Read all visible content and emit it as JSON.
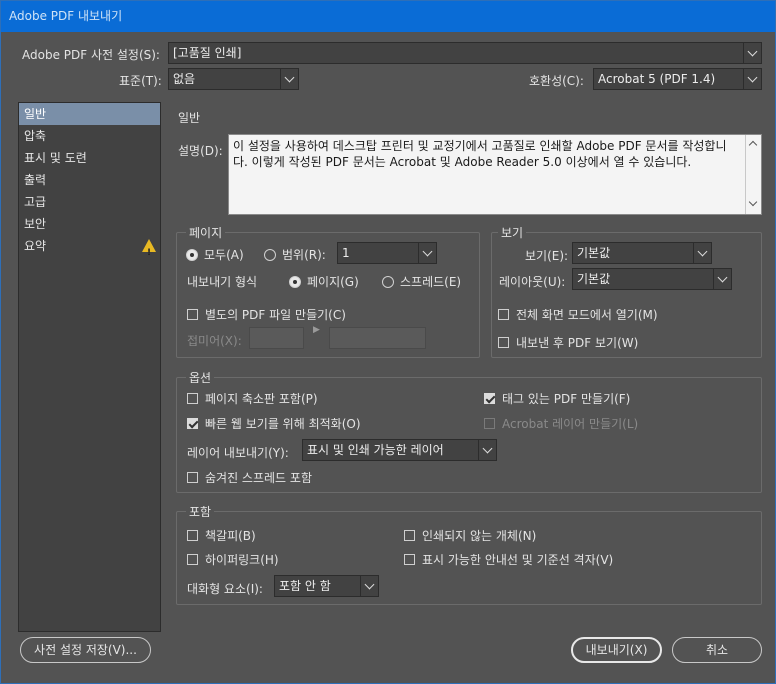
{
  "window": {
    "title": "Adobe PDF 내보내기"
  },
  "header": {
    "preset_label": "Adobe PDF 사전 설정(S):",
    "preset_value": "[고품질 인쇄]",
    "standard_label": "표준(T):",
    "standard_value": "없음",
    "compat_label": "호환성(C):",
    "compat_value": "Acrobat 5 (PDF 1.4)"
  },
  "sidebar": {
    "items": [
      {
        "label": "일반"
      },
      {
        "label": "압축"
      },
      {
        "label": "표시 및 도련"
      },
      {
        "label": "출력"
      },
      {
        "label": "고급"
      },
      {
        "label": "보안"
      },
      {
        "label": "요약"
      }
    ],
    "warning_glyph": "!"
  },
  "general": {
    "section_title": "일반",
    "desc_label": "설명(D):",
    "desc_text": "이 설정을 사용하여 데스크탑 프린터 및 교정기에서 고품질로 인쇄할 Adobe PDF 문서를 작성합니다. 이렇게 작성된 PDF 문서는 Acrobat 및 Adobe Reader 5.0 이상에서 열 수 있습니다."
  },
  "pages": {
    "title": "페이지",
    "all_label": "모두(A)",
    "range_label": "범위(R):",
    "range_value": "1",
    "export_as_label": "내보내기 형식",
    "pages_label": "페이지(G)",
    "spreads_label": "스프레드(E)",
    "separate_label": "별도의 PDF 파일 만들기(C)",
    "suffix_label": "접미어(X):"
  },
  "view": {
    "title": "보기",
    "view_label": "보기(E):",
    "view_value": "기본값",
    "layout_label": "레이아웃(U):",
    "layout_value": "기본값",
    "fullscreen_label": "전체 화면 모드에서 열기(M)",
    "after_export_label": "내보낸 후 PDF 보기(W)"
  },
  "options": {
    "title": "옵션",
    "thumbnails_label": "페이지 축소판 포함(P)",
    "optimize_label": "빠른 웹 보기를 위해 최적화(O)",
    "tagged_label": "태그 있는 PDF 만들기(F)",
    "acrobat_layers_label": "Acrobat 레이어 만들기(L)",
    "export_layers_label": "레이어 내보내기(Y):",
    "export_layers_value": "표시 및 인쇄 가능한 레이어",
    "hidden_spreads_label": "숨겨진 스프레드 포함"
  },
  "include": {
    "title": "포함",
    "bookmarks_label": "책갈피(B)",
    "hyperlinks_label": "하이퍼링크(H)",
    "nonprinting_label": "인쇄되지 않는 개체(N)",
    "guides_label": "표시 가능한 안내선 및 기준선 격자(V)",
    "interactive_label": "대화형 요소(I):",
    "interactive_value": "포함 안 함"
  },
  "footer": {
    "save_preset_label": "사전 설정 저장(V)...",
    "export_label": "내보내기(X)",
    "cancel_label": "취소"
  },
  "colors": {
    "titlebar": "#0a6cd6",
    "panel": "#535353",
    "sidebar_selected": "#7a8fa8",
    "warning": "#e8b923"
  }
}
